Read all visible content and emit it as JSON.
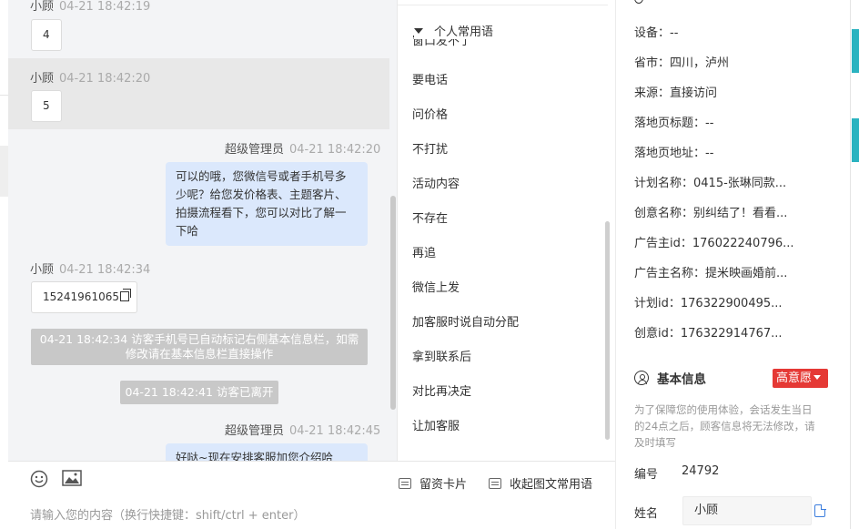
{
  "chat": {
    "messages": [
      {
        "name": "小顾",
        "time": "04-21 18:42:19",
        "text": "4"
      },
      {
        "name": "小顾",
        "time": "04-21 18:42:20",
        "text": "5"
      },
      {
        "name": "超级管理员",
        "time": "04-21 18:42:20",
        "lines": [
          "可以的哦，您微信号或者手机号多",
          "少呢？给您发价格表、主题客片、",
          "拍摄流程看下，您可以对比了解一",
          "下哈"
        ]
      },
      {
        "name": "小顾",
        "time": "04-21 18:42:34",
        "text": "15241961065"
      },
      {
        "name": "超级管理员",
        "time": "04-21 18:42:45",
        "text": "好哒~现在安排客服加您介绍哈"
      }
    ],
    "system": [
      {
        "lines": [
          "04-21 18:42:34 访客手机号已自动标记右侧基本信息栏，如需",
          "修改请在基本信息栏直接操作"
        ]
      },
      {
        "lines": [
          "04-21 18:42:41 访客已离开"
        ]
      }
    ]
  },
  "toolbar": {
    "emoji_icon": "smile-icon",
    "image_icon": "image-icon",
    "card_label": "留资卡片",
    "collapse_label": "收起图文常用语",
    "placeholder": "请输入您的内容（换行快捷键：shift/ctrl + enter）"
  },
  "phrases": {
    "header": "个人常用语",
    "clipped": "窗口发不了",
    "items": [
      "要电话",
      "问价格",
      "不打扰",
      "活动内容",
      "不存在",
      "再追",
      "微信上发",
      "加客服时说自动分配",
      "拿到联系后",
      "对比再决定",
      "让加客服"
    ]
  },
  "info": {
    "rows": [
      {
        "label": "设备：",
        "value": "--"
      },
      {
        "label": "省市：",
        "value": "四川，泸州"
      },
      {
        "label": "来源：",
        "value": "直接访问"
      },
      {
        "label": "落地页标题：",
        "value": "--"
      },
      {
        "label": "落地页地址：",
        "value": "--"
      },
      {
        "label": "计划名称：",
        "value": "0415-张琳同款..."
      },
      {
        "label": "创意名称：",
        "value": "别纠结了！看看..."
      },
      {
        "label": "广告主id：",
        "value": "176022240796..."
      },
      {
        "label": "广告主名称：",
        "value": "提米映画婚前..."
      },
      {
        "label": "计划id：",
        "value": "176322900495..."
      },
      {
        "label": "创意id：",
        "value": "176322914767..."
      }
    ],
    "section_title": "基本信息",
    "intent_badge": "高意愿",
    "note_lines": [
      "为了保障您的使用体验，会话发生当日",
      "的24点之后，顾客信息将无法修改，请",
      "及时填写"
    ],
    "number_label": "编号",
    "number_value": "24792",
    "name_label": "姓名",
    "name_value": "小顾",
    "badge_color": "#e53935"
  }
}
